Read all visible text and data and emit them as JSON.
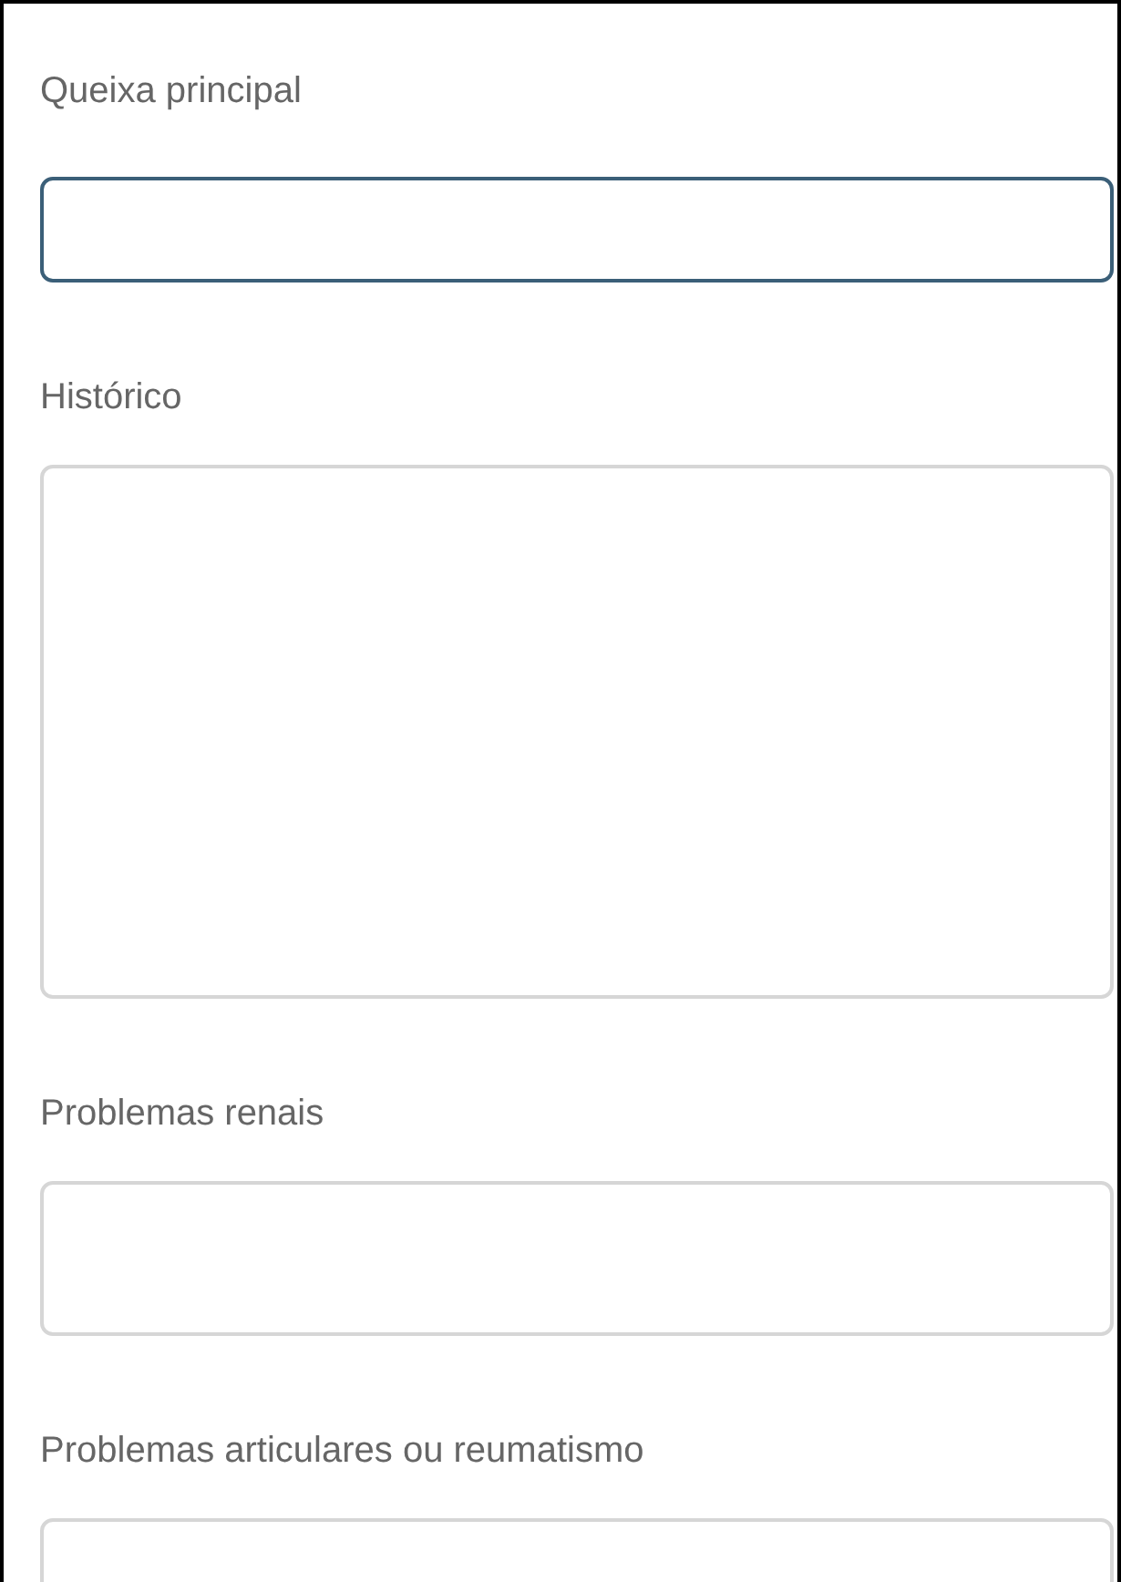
{
  "fields": [
    {
      "label": "Queixa principal",
      "focused": true
    },
    {
      "label": "Histórico",
      "focused": false
    },
    {
      "label": "Problemas renais",
      "focused": false
    },
    {
      "label": "Problemas articulares ou reumatismo",
      "focused": false
    }
  ]
}
